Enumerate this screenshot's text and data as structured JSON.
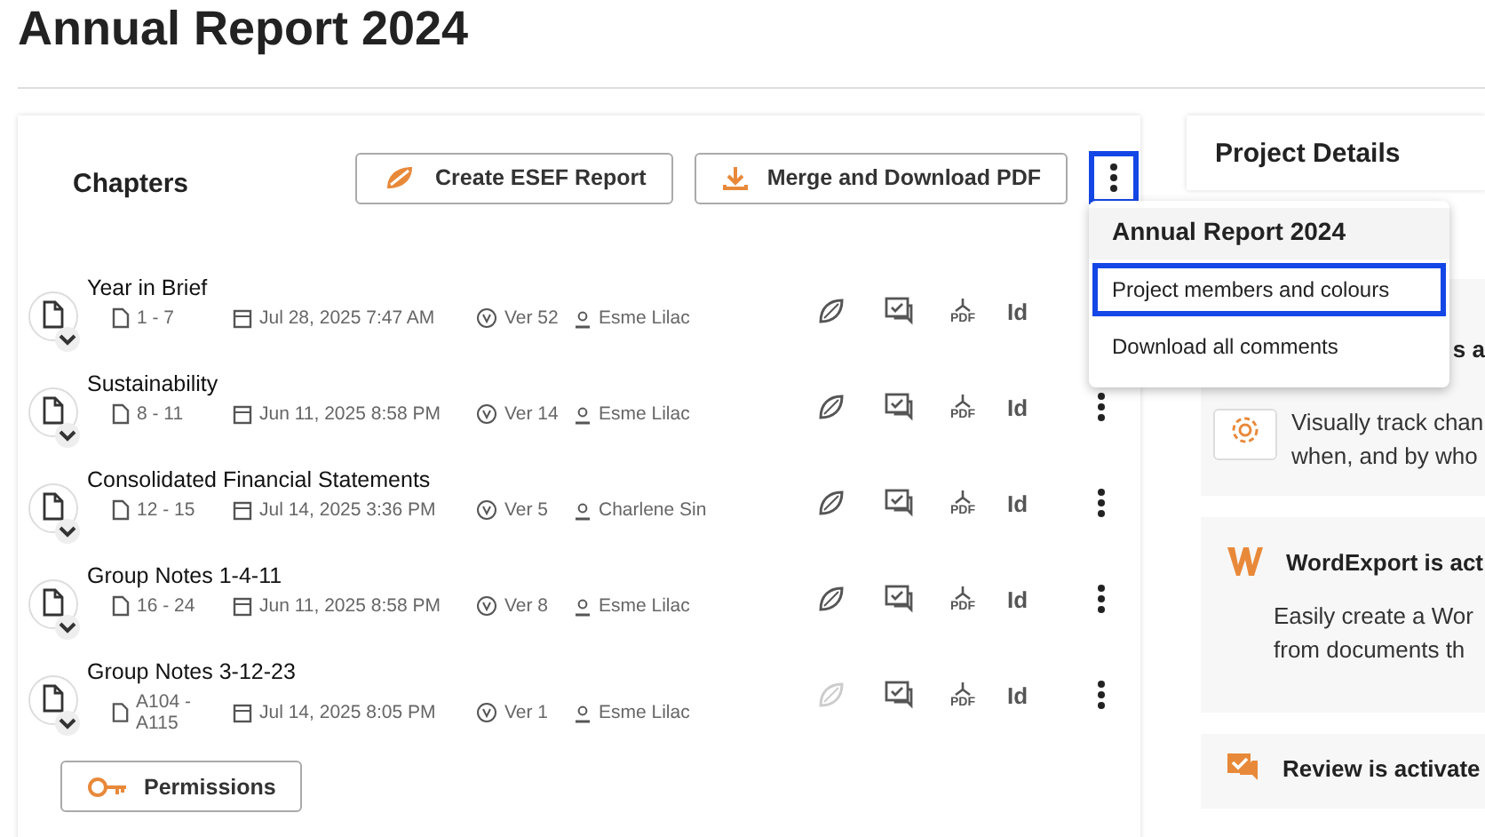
{
  "page_title": "Annual Report 2024",
  "chapters_panel": {
    "title": "Chapters",
    "buttons": [
      {
        "kind": "esef",
        "label": "Create ESEF Report"
      },
      {
        "kind": "download",
        "label": "Merge and Download PDF"
      }
    ],
    "menu_open": true,
    "rows": [
      {
        "title": "Year in Brief",
        "pages": "1 - 7",
        "date": "Jul 28, 2025 7:47 AM",
        "version": "Ver 52",
        "user": "Esme Lilac",
        "esef_enabled": true,
        "pdf_label": "PDF",
        "indesign_label": "Id"
      },
      {
        "title": "Sustainability",
        "pages": "8 - 11",
        "date": "Jun 11, 2025 8:58 PM",
        "version": "Ver 14",
        "user": "Esme Lilac",
        "esef_enabled": true,
        "pdf_label": "PDF",
        "indesign_label": "Id"
      },
      {
        "title": "Consolidated Financial Statements",
        "pages": "12 - 15",
        "date": "Jul 14, 2025 3:36 PM",
        "version": "Ver 5",
        "user": "Charlene Sin",
        "esef_enabled": true,
        "pdf_label": "PDF",
        "indesign_label": "Id"
      },
      {
        "title": "Group Notes 1-4-11",
        "pages": "16 - 24",
        "date": "Jun 11, 2025 8:58 PM",
        "version": "Ver 8",
        "user": "Esme Lilac",
        "esef_enabled": true,
        "pdf_label": "PDF",
        "indesign_label": "Id"
      },
      {
        "title": "Group Notes 3-12-23",
        "pages": "A104 - A115",
        "date": "Jul 14, 2025 8:05 PM",
        "version": "Ver 1",
        "user": "Esme Lilac",
        "esef_enabled": false,
        "pdf_label": "PDF",
        "indesign_label": "Id"
      }
    ],
    "permissions_button": "Permissions"
  },
  "dropdown_menu": {
    "header": "Annual Report 2024",
    "items": [
      {
        "label": "Project members and colours",
        "selected": true
      },
      {
        "label": "Download all comments",
        "selected": false
      }
    ]
  },
  "project_details": {
    "title": "Project Details",
    "cards": [
      {
        "kind": "track",
        "heading": "s a",
        "lines": [
          "Visually track chan",
          "when, and by who"
        ]
      },
      {
        "kind": "word",
        "heading": "WordExport is act",
        "lines": [
          "Easily create a Wor",
          "from documents th"
        ]
      },
      {
        "kind": "review",
        "heading": "Review is activate"
      }
    ]
  }
}
